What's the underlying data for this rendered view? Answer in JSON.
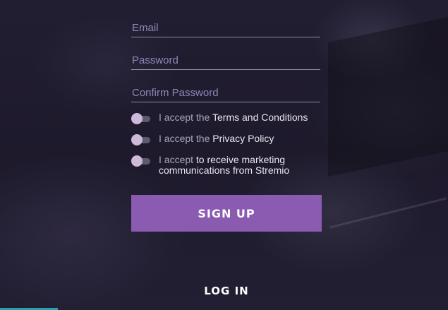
{
  "form": {
    "email": {
      "placeholder": "Email",
      "value": ""
    },
    "password": {
      "placeholder": "Password",
      "value": ""
    },
    "confirm_password": {
      "placeholder": "Confirm Password",
      "value": ""
    }
  },
  "consents": {
    "terms": {
      "prefix": "I accept the ",
      "link": "Terms and Conditions",
      "checked": false
    },
    "privacy": {
      "prefix": "I accept the ",
      "link": "Privacy Policy",
      "checked": false
    },
    "marketing": {
      "prefix": "I accept ",
      "link": "to receive marketing communications from Stremio",
      "checked": false
    }
  },
  "actions": {
    "signup_label": "SIGN UP",
    "login_label": "LOG IN"
  },
  "colors": {
    "background": "#1f1b2e",
    "accent": "#8a5bb0",
    "placeholder": "#8c87b8",
    "toggle_knob": "#cdb9d8",
    "bottom_bar": "#2a9fb0"
  }
}
